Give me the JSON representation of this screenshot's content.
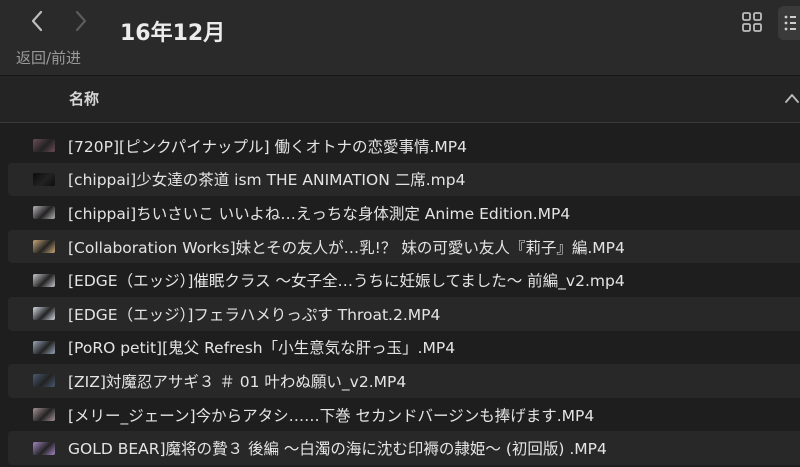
{
  "toolbar": {
    "nav_label": "返回/前进",
    "title": "16年12月"
  },
  "columns": {
    "name": "名称"
  },
  "icons": {
    "back": "chevron-left-icon",
    "forward": "chevron-right-icon",
    "grid_view": "grid-view-icon",
    "list_view": "list-view-icon",
    "sort": "chevron-up-icon",
    "file_thumb": "video-thumbnail-icon"
  },
  "colors": {
    "background": "#1e1e1e",
    "toolbar": "#2a2a2a",
    "alt_row": "#282828",
    "text": "#e4e4e4",
    "muted": "#9a9a9a"
  },
  "files": [
    {
      "name": "[720P][ピンクパイナップル] 働くオトナの恋愛事情.MP4",
      "thumb_color": "#6b4e58"
    },
    {
      "name": "[chippai]少女達の茶道 ism THE ANIMATION 二席.mp4",
      "thumb_color": "#0c0c0c"
    },
    {
      "name": "[chippai]ちいさいこ いいよね…えっちな身体測定 Anime Edition.MP4",
      "thumb_color": "#b8b4b8"
    },
    {
      "name": "[Collaboration Works]妹とその友人が…乳!？ 妹の可愛い友人『莉子』編.MP4",
      "thumb_color": "#c9a878"
    },
    {
      "name": "[EDGE（エッジ）]催眠クラス ～女子全…うちに妊娠してました～ 前編_v2.mp4",
      "thumb_color": "#c8c6cc"
    },
    {
      "name": "[EDGE（エッジ）]フェラハメりっぷす Throat.2.MP4",
      "thumb_color": "#d4dce6"
    },
    {
      "name": "[PoRO petit][鬼父 Refresh「小生意気な肝っ玉」.MP4",
      "thumb_color": "#9aa6b8"
    },
    {
      "name": "[ZIZ]対魔忍アサギ３ ＃ 01 叶わぬ願い_v2.MP4",
      "thumb_color": "#4a5a72"
    },
    {
      "name": "[メリー_ジェーン]今からアタシ……下巻 セカンドバージンも捧げます.MP4",
      "thumb_color": "#a89498"
    },
    {
      "name": "GOLD BEAR]魔将の贄３ 後編 ～白濁の海に沈む印褥の隷姫～ (初回版) .MP4",
      "thumb_color": "#a486c4"
    }
  ]
}
